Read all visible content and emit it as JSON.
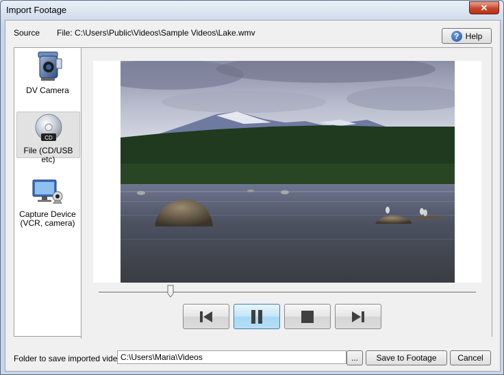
{
  "window": {
    "title": "Import Footage",
    "close_glyph": "✕"
  },
  "source": {
    "label": "Source",
    "file_text": "File: C:\\Users\\Public\\Videos\\Sample Videos\\Lake.wmv"
  },
  "help_button": {
    "label": "Help",
    "icon": "help-icon"
  },
  "sidebar": {
    "items": [
      {
        "label": "DV Camera",
        "icon": "dv-camera-icon",
        "selected": false
      },
      {
        "label": "File (CD/USB etc)",
        "icon": "cd-disc-icon",
        "selected": true
      },
      {
        "label_line1": "Capture Device",
        "label_line2": "(VCR, camera)",
        "icon": "webcam-monitor-icon",
        "selected": false
      }
    ]
  },
  "cd_badge": "CD",
  "playback": {
    "position_fraction": 0.19,
    "controls": [
      {
        "name": "previous",
        "icon": "skip-back-icon"
      },
      {
        "name": "pause",
        "icon": "pause-icon",
        "active": true
      },
      {
        "name": "stop",
        "icon": "stop-icon"
      },
      {
        "name": "next",
        "icon": "skip-forward-icon"
      }
    ]
  },
  "folder": {
    "label": "Folder to save imported video",
    "value": "C:\\Users\\Maria\\Videos",
    "browse_label": "...",
    "save_label": "Save to Footage",
    "cancel_label": "Cancel"
  }
}
